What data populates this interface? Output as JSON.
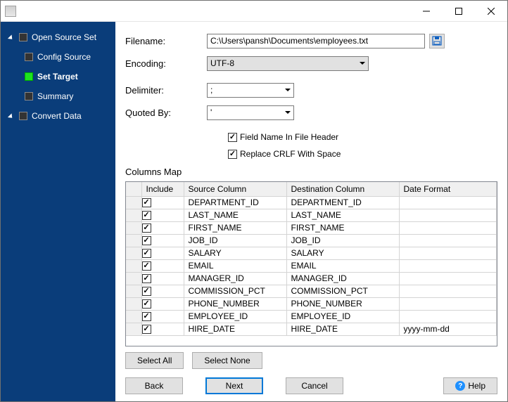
{
  "sidebar": {
    "items": [
      {
        "label": "Open Source Set",
        "active": false,
        "level": 0
      },
      {
        "label": "Config Source",
        "active": false,
        "level": 1
      },
      {
        "label": "Set Target",
        "active": true,
        "level": 1
      },
      {
        "label": "Summary",
        "active": false,
        "level": 1
      },
      {
        "label": "Convert Data",
        "active": false,
        "level": 0
      }
    ]
  },
  "form": {
    "filename_label": "Filename:",
    "filename_value": "C:\\Users\\pansh\\Documents\\employees.txt",
    "encoding_label": "Encoding:",
    "encoding_value": "UTF-8",
    "delimiter_label": "Delimiter:",
    "delimiter_value": ";",
    "quoted_label": "Quoted By:",
    "quoted_value": "'",
    "chk_header_label": "Field Name In File Header",
    "chk_header_checked": true,
    "chk_crlf_label": "Replace CRLF With Space",
    "chk_crlf_checked": true
  },
  "columns_map": {
    "title": "Columns Map",
    "headers": {
      "include": "Include",
      "source": "Source Column",
      "dest": "Destination Column",
      "fmt": "Date Format"
    },
    "rows": [
      {
        "include": true,
        "source": "DEPARTMENT_ID",
        "dest": "DEPARTMENT_ID",
        "fmt": ""
      },
      {
        "include": true,
        "source": "LAST_NAME",
        "dest": "LAST_NAME",
        "fmt": ""
      },
      {
        "include": true,
        "source": "FIRST_NAME",
        "dest": "FIRST_NAME",
        "fmt": ""
      },
      {
        "include": true,
        "source": "JOB_ID",
        "dest": "JOB_ID",
        "fmt": ""
      },
      {
        "include": true,
        "source": "SALARY",
        "dest": "SALARY",
        "fmt": ""
      },
      {
        "include": true,
        "source": "EMAIL",
        "dest": "EMAIL",
        "fmt": ""
      },
      {
        "include": true,
        "source": "MANAGER_ID",
        "dest": "MANAGER_ID",
        "fmt": ""
      },
      {
        "include": true,
        "source": "COMMISSION_PCT",
        "dest": "COMMISSION_PCT",
        "fmt": ""
      },
      {
        "include": true,
        "source": "PHONE_NUMBER",
        "dest": "PHONE_NUMBER",
        "fmt": ""
      },
      {
        "include": true,
        "source": "EMPLOYEE_ID",
        "dest": "EMPLOYEE_ID",
        "fmt": ""
      },
      {
        "include": true,
        "source": "HIRE_DATE",
        "dest": "HIRE_DATE",
        "fmt": "yyyy-mm-dd"
      }
    ]
  },
  "buttons": {
    "select_all": "Select All",
    "select_none": "Select None",
    "back": "Back",
    "next": "Next",
    "cancel": "Cancel",
    "help": "Help"
  }
}
